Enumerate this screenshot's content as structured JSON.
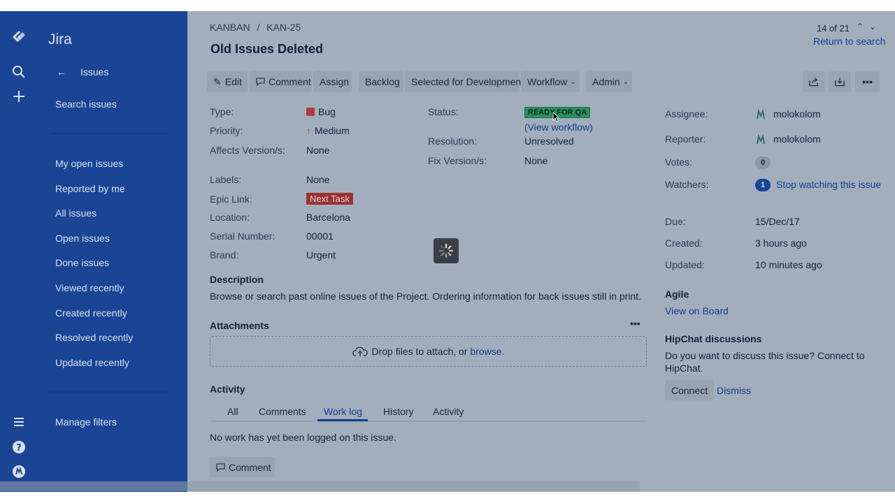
{
  "app": {
    "name": "Jira"
  },
  "sidebar": {
    "back_label": "Issues",
    "search_label": "Search issues",
    "filters": [
      "My open issues",
      "Reported by me",
      "All issues",
      "Open issues",
      "Done issues",
      "Viewed recently",
      "Created recently",
      "Resolved recently",
      "Updated recently"
    ],
    "manage_filters": "Manage filters"
  },
  "issue": {
    "breadcrumb_project": "KANBAN",
    "breadcrumb_sep": "/",
    "breadcrumb_key": "KAN-25",
    "title": "Old Issues Deleted",
    "pager": "14 of 21",
    "return_to_search": "Return to search"
  },
  "toolbar": {
    "edit": "Edit",
    "comment": "Comment",
    "assign": "Assign",
    "backlog": "Backlog",
    "selected_for_dev": "Selected for Development",
    "workflow": "Workflow",
    "admin": "Admin"
  },
  "details": {
    "type_label": "Type:",
    "type_value": "Bug",
    "priority_label": "Priority:",
    "priority_value": "Medium",
    "affects_label": "Affects Version/s:",
    "affects_value": "None",
    "labels_label": "Labels:",
    "labels_value": "None",
    "epic_label": "Epic Link:",
    "epic_value": "Next Task",
    "location_label": "Location:",
    "location_value": "Barcelona",
    "serial_label": "Serial Number:",
    "serial_value": "00001",
    "brand_label": "Brand:",
    "brand_value": "Urgent",
    "status_label": "Status:",
    "status_value": "READY FOR QA",
    "view_workflow": "(View workflow)",
    "resolution_label": "Resolution:",
    "resolution_value": "Unresolved",
    "fix_label": "Fix Version/s:",
    "fix_value": "None"
  },
  "people": {
    "assignee_label": "Assignee:",
    "assignee_value": "molokolom",
    "reporter_label": "Reporter:",
    "reporter_value": "molokolom",
    "votes_label": "Votes:",
    "votes_value": "0",
    "watchers_label": "Watchers:",
    "watchers_value": "1",
    "stop_watching": "Stop watching this issue"
  },
  "dates": {
    "due_label": "Due:",
    "due_value": "15/Dec/17",
    "created_label": "Created:",
    "created_value": "3 hours ago",
    "updated_label": "Updated:",
    "updated_value": "10 minutes ago"
  },
  "agile": {
    "heading": "Agile",
    "view_on_board": "View on Board"
  },
  "hipchat": {
    "heading": "HipChat discussions",
    "text_line1": "Do you want to discuss this issue? Connect to",
    "text_line2": "HipChat.",
    "connect": "Connect",
    "dismiss": "Dismiss"
  },
  "description": {
    "heading": "Description",
    "text": "Browse or search past online issues of the Project. Ordering information for back issues still in print."
  },
  "attachments": {
    "heading": "Attachments",
    "drop_text": "Drop files to attach, or",
    "browse": "browse."
  },
  "activity": {
    "heading": "Activity",
    "tabs": [
      "All",
      "Comments",
      "Work log",
      "History",
      "Activity"
    ],
    "active_tab": "Work log",
    "empty_text": "No work has yet been logged on this issue.",
    "comment_button": "Comment"
  },
  "colors": {
    "sidebar_bg": "#1a4595",
    "overlay_bg": "#a3aebd",
    "status_green": "#2a8f62",
    "epic_red": "#993333",
    "link_blue": "#0f3f8f",
    "active_tab": "#0f3f8f"
  }
}
